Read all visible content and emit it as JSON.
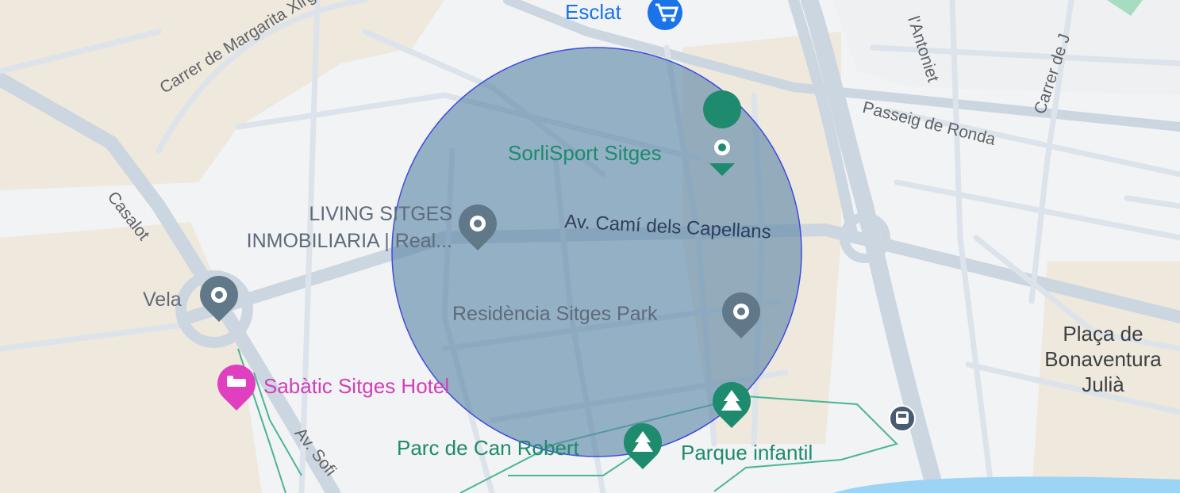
{
  "map": {
    "colors": {
      "land": "#f1f3f4",
      "zone": "#efe8dc",
      "road": "#dde3ea",
      "road_major": "#ccd6e0",
      "park": "#2e9f78",
      "poi_gray": "#607888",
      "poi_pink": "#e040c0",
      "circle_fill": "#5b86a6",
      "circle_stroke": "#3d4ce0"
    },
    "streets": {
      "margarita": "Carrer de Margarita Xirgu",
      "casalot": "Casalot",
      "ronda": "Passeig de Ronda",
      "antoniet": "l'Antoniet",
      "carrer_de": "Carrer de J",
      "cami": "Av. Camí dels Capellans",
      "sofia": "Av. Sofi"
    },
    "pois": {
      "esclat": "Esclat",
      "sorlisport": "SorliSport Sitges",
      "living_line1": "LIVING SITGES",
      "living_line2": "INMOBILIARIA | Real...",
      "vela": "Vela",
      "residencia": "Residència Sitges Park",
      "sabatic": "Sabàtic Sitges Hotel",
      "parc_can_robert": "Parc de Can Robert",
      "parque_infantil": "Parque infantil"
    },
    "places": {
      "placa_line1": "Plaça de",
      "placa_line2": "Bonaventura",
      "placa_line3": "Julià"
    },
    "icons": {
      "esclat": "shopping-cart-icon",
      "sorlisport": "place-pin-icon",
      "living": "place-pin-icon",
      "vela": "place-pin-icon",
      "residencia": "place-pin-icon",
      "sabatic": "hotel-bed-icon",
      "parks": "tree-icon",
      "bus": "bus-stop-icon"
    }
  }
}
